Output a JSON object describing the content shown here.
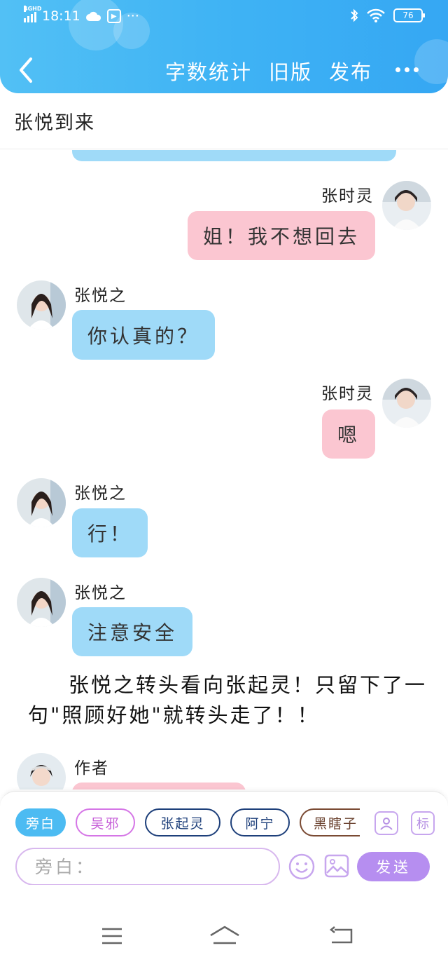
{
  "status_bar": {
    "network": "4GHD",
    "time": "18:11",
    "battery": "76",
    "more": "···"
  },
  "header": {
    "actions": [
      "字数统计",
      "旧版",
      "发布"
    ]
  },
  "title": "张悦到来",
  "messages": [
    {
      "side": "right",
      "sender": "张时灵",
      "text": "姐！我不想回去",
      "color": "pink"
    },
    {
      "side": "left",
      "sender": "张悦之",
      "text": "你认真的？",
      "color": "blue"
    },
    {
      "side": "right",
      "sender": "张时灵",
      "text": "嗯",
      "color": "pink"
    },
    {
      "side": "left",
      "sender": "张悦之",
      "text": "行！",
      "color": "blue"
    },
    {
      "side": "left",
      "sender": "张悦之",
      "text": "注意安全",
      "color": "blue"
    }
  ],
  "narration": "张悦之转头看向张起灵！只留下了一句\"照顾好她\"就转头走了！！",
  "last_sender": "作者",
  "input_area": {
    "roles": [
      "旁白",
      "吴邪",
      "张起灵",
      "阿宁",
      "黑瞎子"
    ],
    "placeholder": "旁白：",
    "send_label": "发送",
    "tag_label": "标"
  },
  "colors": {
    "header": "#3fb3f4",
    "bubble_blue": "#9fdaf8",
    "bubble_pink": "#fbc6d1",
    "send": "#b68ef0"
  }
}
